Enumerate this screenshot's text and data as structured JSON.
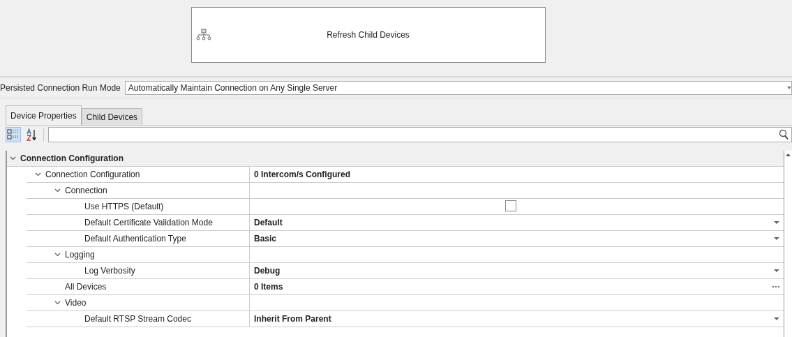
{
  "action_button": {
    "label": "Refresh Child Devices"
  },
  "run_mode": {
    "label": "Persisted Connection Run Mode",
    "value": "Automatically Maintain Connection on Any Single Server"
  },
  "tabs": [
    {
      "label": "Device Properties",
      "selected": true
    },
    {
      "label": "Child Devices",
      "selected": false
    }
  ],
  "toolbar": {
    "categorized_selected": true,
    "alphabetical_selected": false
  },
  "properties": [
    {
      "kind": "category",
      "label": "Connection Configuration",
      "expanded": true,
      "children": [
        {
          "kind": "group",
          "label": "Connection Configuration",
          "value": "0 Intercom/s Configured",
          "expanded": true,
          "children": [
            {
              "kind": "group",
              "label": "Connection",
              "expanded": true,
              "children": [
                {
                  "kind": "checkbox",
                  "label": "Use HTTPS (Default)",
                  "checked": false
                },
                {
                  "kind": "dropdown",
                  "label": "Default Certificate Validation Mode",
                  "value": "Default"
                },
                {
                  "kind": "dropdown",
                  "label": "Default Authentication Type",
                  "value": "Basic"
                }
              ]
            },
            {
              "kind": "group",
              "label": "Logging",
              "expanded": true,
              "children": [
                {
                  "kind": "dropdown",
                  "label": "Log Verbosity",
                  "value": "Debug"
                }
              ]
            },
            {
              "kind": "ellipsis",
              "label": "All Devices",
              "value": "0 Items"
            },
            {
              "kind": "group",
              "label": "Video",
              "expanded": true,
              "children": [
                {
                  "kind": "dropdown",
                  "label": "Default RTSP Stream Codec",
                  "value": "Inherit From Parent"
                }
              ]
            }
          ]
        }
      ]
    }
  ]
}
